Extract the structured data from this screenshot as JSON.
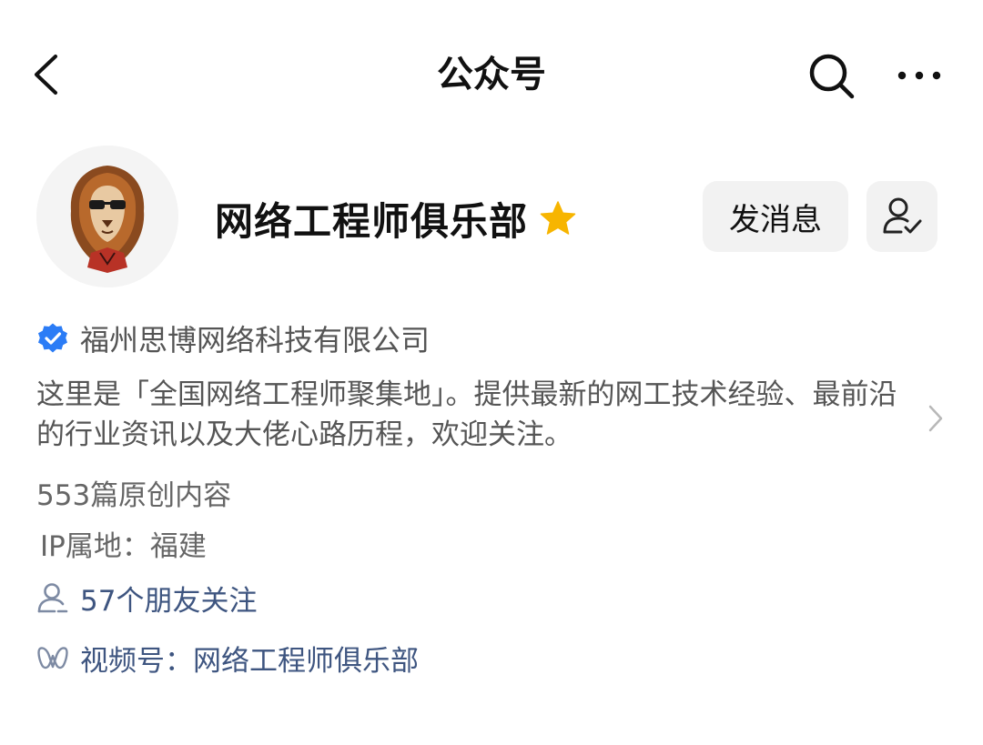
{
  "navbar": {
    "back_icon": "chevron-left-icon",
    "title": "公众号",
    "search_icon": "search-icon",
    "more_icon": "more-dots-icon"
  },
  "profile": {
    "avatar_icon": "lion-avatar-icon",
    "name": "网络工程师俱乐部",
    "star_icon": "star-icon",
    "star_color": "#f7b500",
    "send_message_label": "发消息",
    "follow_icon": "user-check-icon"
  },
  "info": {
    "verified_icon": "verified-badge-icon",
    "verified_color": "#2b7cf6",
    "company": "福州思博网络科技有限公司",
    "description": "这里是「全国网络工程师聚集地」。提供最新的网工技术经验、最前沿的行业资讯以及大佬心路历程，欢迎关注。",
    "description_chevron": "chevron-right-icon",
    "original_count": "553篇原创内容",
    "ip_location": "IP属地：福建",
    "friends_icon": "user-icon",
    "friends_following": "57个朋友关注",
    "channels_icon": "channels-icon",
    "channels": "视频号：网络工程师俱乐部",
    "link_color": "#3e5580"
  }
}
